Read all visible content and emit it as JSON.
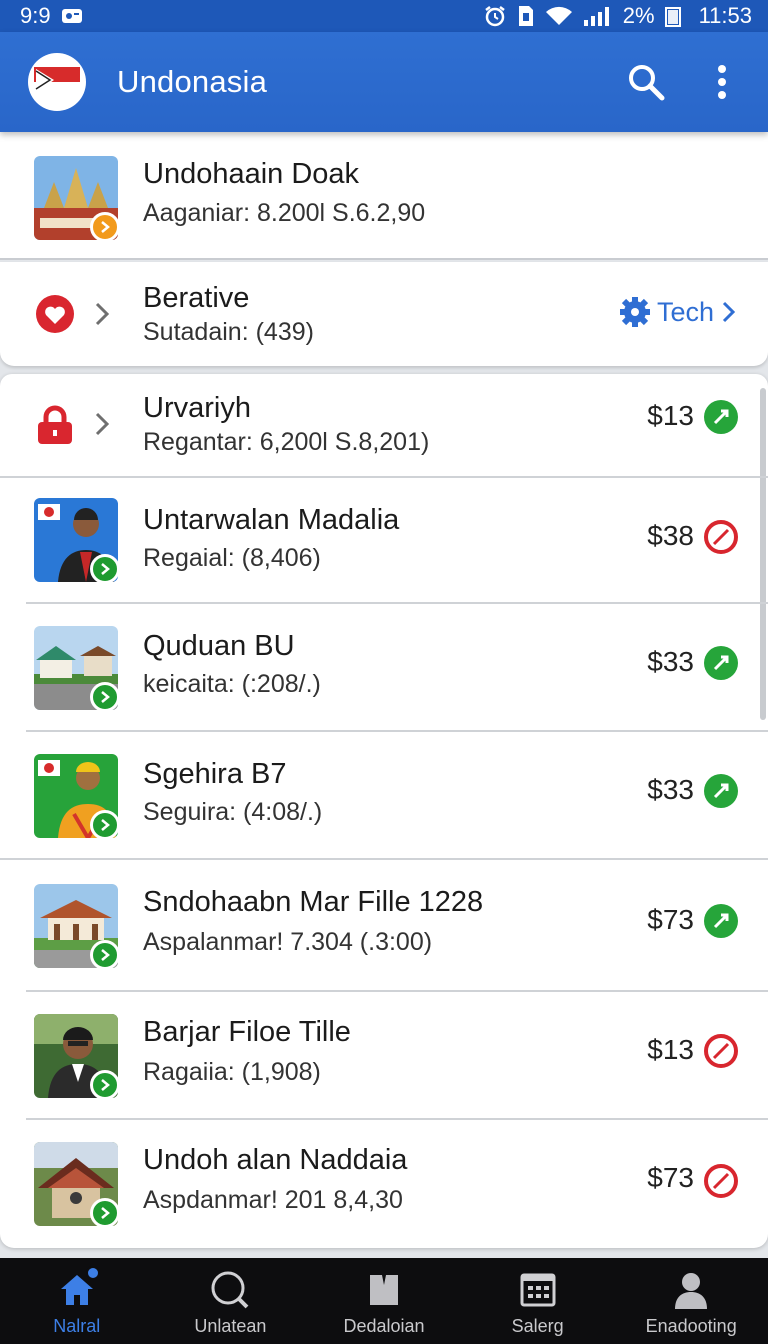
{
  "status_bar": {
    "left_time": "9:9",
    "battery": "2%",
    "clock": "11:53"
  },
  "app_bar": {
    "title": "Undonasia"
  },
  "featured": {
    "title": "Undohaain Doak",
    "subtitle": "Aaganiar: 8.200l S.6.2,90"
  },
  "category": {
    "title": "Berative",
    "subtitle": "Sutadain: (439)",
    "action_label": "Tech"
  },
  "items": [
    {
      "title": "Urvariyh",
      "subtitle": "Regantar: 6,200l S.8,201)",
      "price": "$13",
      "status": "ok"
    },
    {
      "title": "Untarwalan Madalia",
      "subtitle": "Regaial: (8,406)",
      "price": "$38",
      "status": "bad"
    },
    {
      "title": "Quduan BU",
      "subtitle": "keicaita: (:208/.)",
      "price": "$33",
      "status": "ok"
    },
    {
      "title": "Sgehira B7",
      "subtitle": "Seguira: (4:08/.)",
      "price": "$33",
      "status": "ok"
    },
    {
      "title": "Sndohaabn Mar Fille 1228",
      "subtitle": "Aspalanmar! 7.304 (.3:00)",
      "price": "$73",
      "status": "ok"
    },
    {
      "title": "Barjar Filoe Tille",
      "subtitle": "Ragaiia: (1,908)",
      "price": "$13",
      "status": "bad"
    },
    {
      "title": "Undoh alan Naddaia",
      "subtitle": "Aspdanmar! 201 8,4,30",
      "price": "$73",
      "status": "bad"
    }
  ],
  "bottom_nav": [
    {
      "label": "Nalral",
      "icon": "home-icon",
      "active": true
    },
    {
      "label": "Unlatean",
      "icon": "search-icon",
      "active": false
    },
    {
      "label": "Dedaloian",
      "icon": "bookmark-icon",
      "active": false
    },
    {
      "label": "Salerg",
      "icon": "calendar-icon",
      "active": false
    },
    {
      "label": "Enadooting",
      "icon": "person-icon",
      "active": false
    }
  ],
  "colors": {
    "primary": "#2966c9",
    "status_ok": "#26a53a",
    "status_bad": "#d8262e",
    "badge": "#1f9b30",
    "nav_bg": "#0d0d0f"
  }
}
